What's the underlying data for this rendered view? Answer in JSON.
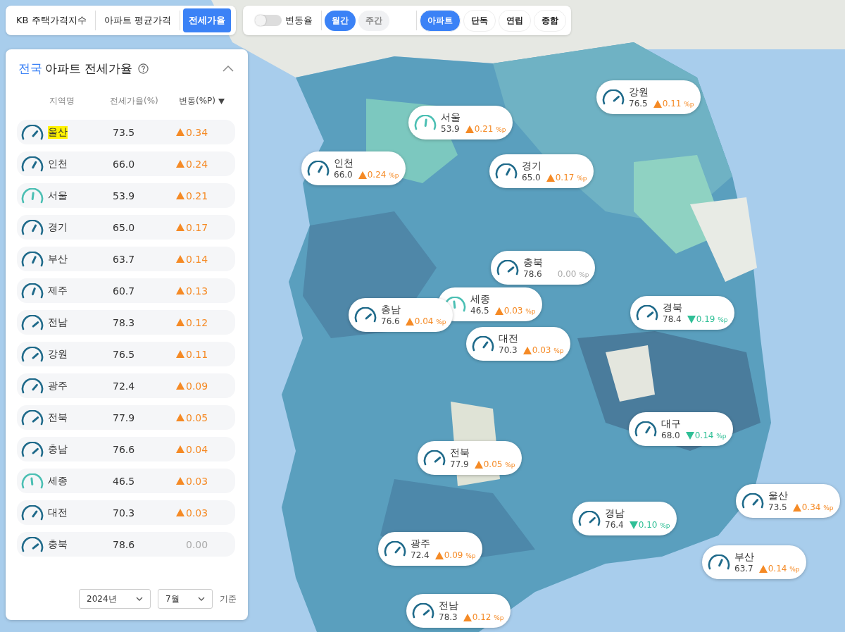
{
  "index_tabs": [
    {
      "label": "KB 주택가격지수",
      "selected": false
    },
    {
      "label": "아파트 평균가격",
      "selected": false
    },
    {
      "label": "전세가율",
      "selected": true
    }
  ],
  "change_toggle": {
    "label": "변동율",
    "on": false
  },
  "period_tabs": [
    {
      "label": "월간",
      "selected": true
    },
    {
      "label": "주간",
      "selected": false
    }
  ],
  "type_tabs": [
    {
      "label": "아파트",
      "selected": true
    },
    {
      "label": "단독",
      "selected": false
    },
    {
      "label": "연립",
      "selected": false
    },
    {
      "label": "종합",
      "selected": false
    }
  ],
  "panel": {
    "region": "전국",
    "title": "아파트 전세가율",
    "expanded": true,
    "columns": [
      "지역명",
      "전세가율(%)",
      "변동(%P)"
    ],
    "rows": [
      {
        "name": "울산",
        "rate": "73.5",
        "change": "0.34",
        "kind": "up",
        "highlighted": true
      },
      {
        "name": "인천",
        "rate": "66.0",
        "change": "0.24",
        "kind": "up",
        "highlighted": false
      },
      {
        "name": "서울",
        "rate": "53.9",
        "change": "0.21",
        "kind": "up",
        "highlighted": false
      },
      {
        "name": "경기",
        "rate": "65.0",
        "change": "0.17",
        "kind": "up",
        "highlighted": false
      },
      {
        "name": "부산",
        "rate": "63.7",
        "change": "0.14",
        "kind": "up",
        "highlighted": false
      },
      {
        "name": "제주",
        "rate": "60.7",
        "change": "0.13",
        "kind": "up",
        "highlighted": false
      },
      {
        "name": "전남",
        "rate": "78.3",
        "change": "0.12",
        "kind": "up",
        "highlighted": false
      },
      {
        "name": "강원",
        "rate": "76.5",
        "change": "0.11",
        "kind": "up",
        "highlighted": false
      },
      {
        "name": "광주",
        "rate": "72.4",
        "change": "0.09",
        "kind": "up",
        "highlighted": false
      },
      {
        "name": "전북",
        "rate": "77.9",
        "change": "0.05",
        "kind": "up",
        "highlighted": false
      },
      {
        "name": "충남",
        "rate": "76.6",
        "change": "0.04",
        "kind": "up",
        "highlighted": false
      },
      {
        "name": "세종",
        "rate": "46.5",
        "change": "0.03",
        "kind": "up",
        "highlighted": false
      },
      {
        "name": "대전",
        "rate": "70.3",
        "change": "0.03",
        "kind": "up",
        "highlighted": false
      },
      {
        "name": "충북",
        "rate": "78.6",
        "change": "0.00",
        "kind": "flat",
        "highlighted": false
      }
    ],
    "year": "2024년",
    "month": "7월",
    "basis": "기준"
  },
  "map": {
    "kind": "picture",
    "markers": [
      {
        "name": "강원",
        "rate": "76.5",
        "change": "0.11",
        "unit": "%p",
        "kind": "up"
      },
      {
        "name": "서울",
        "rate": "53.9",
        "change": "0.21",
        "unit": "%p",
        "kind": "up"
      },
      {
        "name": "인천",
        "rate": "66.0",
        "change": "0.24",
        "unit": "%p",
        "kind": "up"
      },
      {
        "name": "경기",
        "rate": "65.0",
        "change": "0.17",
        "unit": "%p",
        "kind": "up"
      },
      {
        "name": "충북",
        "rate": "78.6",
        "change": "0.00",
        "unit": "%p",
        "kind": "flat"
      },
      {
        "name": "세종",
        "rate": "46.5",
        "change": "0.03",
        "unit": "%p",
        "kind": "up"
      },
      {
        "name": "충남",
        "rate": "76.6",
        "change": "0.04",
        "unit": "%p",
        "kind": "up"
      },
      {
        "name": "경북",
        "rate": "78.4",
        "change": "0.19",
        "unit": "%p",
        "kind": "down"
      },
      {
        "name": "대전",
        "rate": "70.3",
        "change": "0.03",
        "unit": "%p",
        "kind": "up"
      },
      {
        "name": "대구",
        "rate": "68.0",
        "change": "0.14",
        "unit": "%p",
        "kind": "down"
      },
      {
        "name": "전북",
        "rate": "77.9",
        "change": "0.05",
        "unit": "%p",
        "kind": "up"
      },
      {
        "name": "울산",
        "rate": "73.5",
        "change": "0.34",
        "unit": "%p",
        "kind": "up"
      },
      {
        "name": "경남",
        "rate": "76.4",
        "change": "0.10",
        "unit": "%p",
        "kind": "down"
      },
      {
        "name": "광주",
        "rate": "72.4",
        "change": "0.09",
        "unit": "%p",
        "kind": "up"
      },
      {
        "name": "부산",
        "rate": "63.7",
        "change": "0.14",
        "unit": "%p",
        "kind": "up"
      },
      {
        "name": "전남",
        "rate": "78.3",
        "change": "0.12",
        "unit": "%p",
        "kind": "up"
      }
    ]
  }
}
